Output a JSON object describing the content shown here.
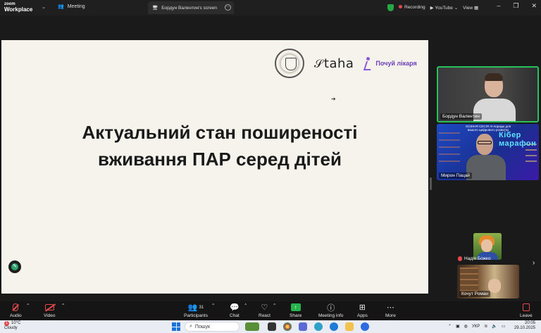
{
  "titlebar": {
    "logo_line1": "zoom",
    "logo_line2": "Workplace",
    "meeting_tab": "Meeting",
    "screen_tab": "Бордун Валентин's screen",
    "recording": "Recording",
    "youtube": "YouTube",
    "view": "View"
  },
  "slide": {
    "title": "Актуальний стан поширеності вживання ПАР серед дітей",
    "logo_taha": "taha",
    "logo_pochui": "Почуй лікаря"
  },
  "participants": [
    {
      "name": "Бордун Валентин"
    },
    {
      "name": "Мирон Пацай",
      "banner": "ОСІННЯ СЕСІЯ\nAI-поради для вашого цифрового розвитку",
      "banner_big": "Кібер марафон"
    },
    {
      "name": "Надія Божко"
    },
    {
      "name": "Кочут Роман"
    }
  ],
  "toolbar": {
    "audio": "Audio",
    "video": "Video",
    "participants": "Participants",
    "participants_count": "31",
    "chat": "Chat",
    "react": "React",
    "share": "Share",
    "meeting_info": "Meeting info",
    "apps": "Apps",
    "more": "More",
    "leave": "Leave"
  },
  "taskbar": {
    "weather_temp": "10°C",
    "weather_desc": "Cloudy",
    "weather_badge": "1",
    "search_placeholder": "Пошук",
    "language": "УКР",
    "time": "20:05",
    "date": "29.10.2025"
  },
  "colors": {
    "recording_dot": "#e5484d",
    "share_green": "#27b34d",
    "active_speaker_border": "#27c25a",
    "pochui_purple": "#6a3fb5"
  }
}
